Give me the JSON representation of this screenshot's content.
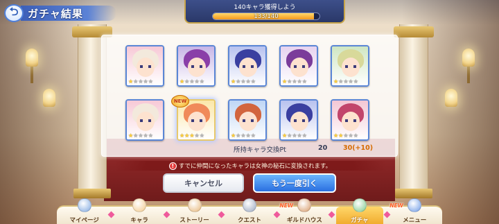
{
  "header": {
    "title": "ガチャ結果",
    "back_icon": "back-arrow-icon"
  },
  "mission": {
    "text": "140キャラ獲得しよう",
    "progress_label": "133/140",
    "current": 133,
    "total": 140
  },
  "results": [
    {
      "stars": 1,
      "hair": "#f3e9dc",
      "bg": "#f7c9d6",
      "rare": false
    },
    {
      "stars": 1,
      "hair": "#8a3fa8",
      "bg": "#c7b5e6",
      "rare": false
    },
    {
      "stars": 1,
      "hair": "#3a3fa0",
      "bg": "#b8c2ef",
      "rare": false
    },
    {
      "stars": 1,
      "hair": "#7b3c9a",
      "bg": "#e7d3ef",
      "rare": false
    },
    {
      "stars": 1,
      "hair": "#d8d99a",
      "bg": "#cfe6c2",
      "rare": false
    },
    {
      "stars": 1,
      "hair": "#f3e9dc",
      "bg": "#f7c9d6",
      "rare": false
    },
    {
      "stars": 3,
      "hair": "#f08a5a",
      "bg": "#fbe7a9",
      "rare": true
    },
    {
      "stars": 1,
      "hair": "#d2653e",
      "bg": "#bfd6f5",
      "rare": false
    },
    {
      "stars": 1,
      "hair": "#3a3fa0",
      "bg": "#b8c2ef",
      "rare": false
    },
    {
      "stars": 2,
      "hair": "#c2456b",
      "bg": "#f3c6d4",
      "rare": false
    }
  ],
  "new_badge": "NEW",
  "exchange": {
    "label": "所持キャラ交換Pt",
    "before": "20",
    "after": "30(+10)"
  },
  "notice": {
    "icon": "!",
    "text": "すでに仲間になったキャラは女神の秘石に変換されます。"
  },
  "buttons": {
    "cancel": "キャンセル",
    "retry": "もう一度引く"
  },
  "nav": [
    {
      "label": "マイページ",
      "icon_color": "#7fa8e0",
      "active": false,
      "new": ""
    },
    {
      "label": "キャラ",
      "icon_color": "#f2c98a",
      "active": false,
      "new": ""
    },
    {
      "label": "ストーリー",
      "icon_color": "#e6b77a",
      "active": false,
      "new": ""
    },
    {
      "label": "クエスト",
      "icon_color": "#9aa7c0",
      "active": false,
      "new": ""
    },
    {
      "label": "ギルドハウス",
      "icon_color": "#d79b6a",
      "active": false,
      "new": "NEW"
    },
    {
      "label": "ガチャ",
      "icon_color": "#7dc98a",
      "active": true,
      "new": ""
    },
    {
      "label": "メニュー",
      "icon_color": "#6e9be6",
      "active": false,
      "new": "NEW"
    }
  ]
}
